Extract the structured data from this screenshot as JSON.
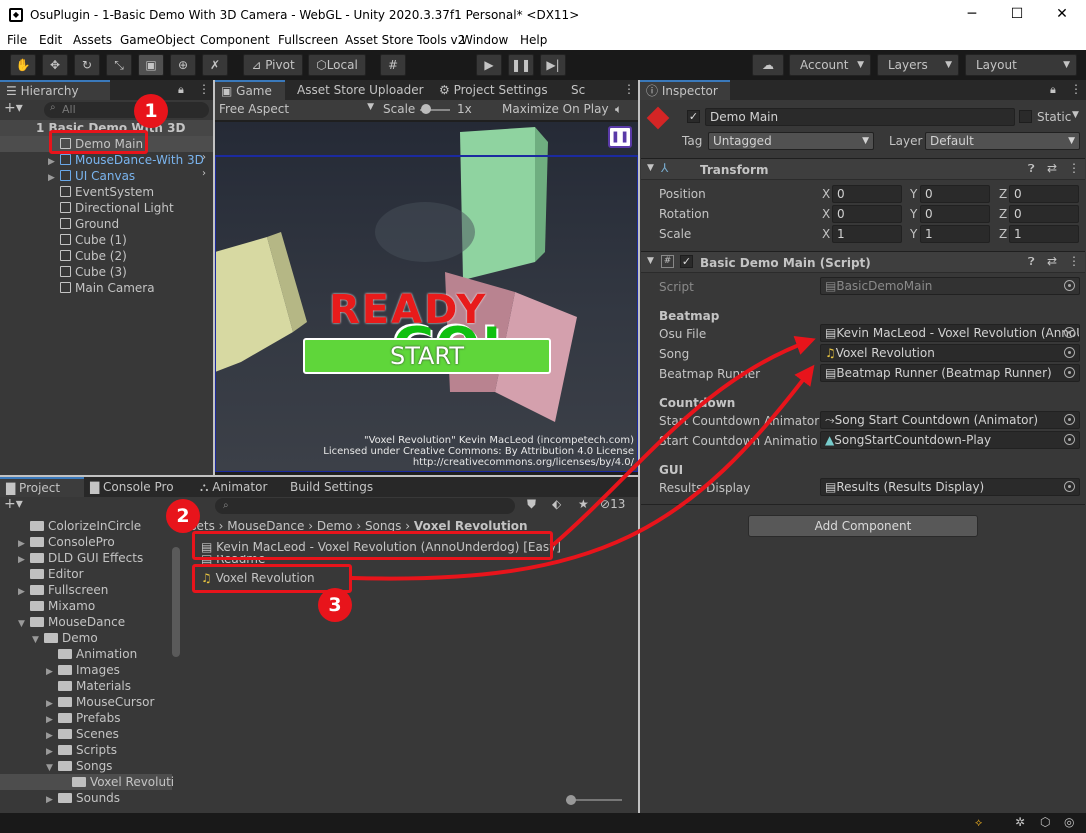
{
  "window": {
    "title": "OsuPlugin - 1-Basic Demo With 3D Camera - WebGL - Unity 2020.3.37f1 Personal* <DX11>"
  },
  "menu": [
    "File",
    "Edit",
    "Assets",
    "GameObject",
    "Component",
    "Fullscreen",
    "Asset Store Tools v2",
    "Window",
    "Help"
  ],
  "toolbar": {
    "pivot": "Pivot",
    "local": "Local",
    "account": "Account",
    "layers": "Layers",
    "layout": "Layout"
  },
  "hierarchy": {
    "tab": "Hierarchy",
    "search_placeholder": "All",
    "scene": "1 Basic Demo With 3D",
    "items": [
      "Demo Main",
      "MouseDance-With 3D",
      "UI Canvas",
      "EventSystem",
      "Directional Light",
      "Ground",
      "Cube (1)",
      "Cube (2)",
      "Cube (3)",
      "Main Camera"
    ]
  },
  "game": {
    "tabs": [
      "Game",
      "Asset Store Uploader",
      "Project Settings",
      "Sc"
    ],
    "aspect": "Free Aspect",
    "scale_label": "Scale",
    "scale_value": "1x",
    "maximize": "Maximize On Play",
    "ready": "READY",
    "go": "GO!",
    "start": "START",
    "credit_1": "\"Voxel Revolution\" Kevin MacLeod (incompetech.com)",
    "credit_2": "Licensed under Creative Commons: By Attribution 4.0 License",
    "credit_3": "http://creativecommons.org/licenses/by/4.0/"
  },
  "project": {
    "tabs": [
      "Project",
      "Console Pro",
      "Animator",
      "Build Settings"
    ],
    "hidden_count": "13",
    "tree": [
      {
        "label": "ColorizeInCircle",
        "indent": 1,
        "arrow": false
      },
      {
        "label": "ConsolePro",
        "indent": 1,
        "arrow": true
      },
      {
        "label": "DLD GUI Effects",
        "indent": 1,
        "arrow": true
      },
      {
        "label": "Editor",
        "indent": 1,
        "arrow": false
      },
      {
        "label": "Fullscreen",
        "indent": 1,
        "arrow": true
      },
      {
        "label": "Mixamo",
        "indent": 1,
        "arrow": false
      },
      {
        "label": "MouseDance",
        "indent": 1,
        "arrow": true,
        "open": true
      },
      {
        "label": "Demo",
        "indent": 2,
        "arrow": true,
        "open": true
      },
      {
        "label": "Animation",
        "indent": 3,
        "arrow": false
      },
      {
        "label": "Images",
        "indent": 3,
        "arrow": true
      },
      {
        "label": "Materials",
        "indent": 3,
        "arrow": false
      },
      {
        "label": "MouseCursor",
        "indent": 3,
        "arrow": true
      },
      {
        "label": "Prefabs",
        "indent": 3,
        "arrow": true
      },
      {
        "label": "Scenes",
        "indent": 3,
        "arrow": true
      },
      {
        "label": "Scripts",
        "indent": 3,
        "arrow": true
      },
      {
        "label": "Songs",
        "indent": 3,
        "arrow": true,
        "open": true
      },
      {
        "label": "Voxel Revoluti",
        "indent": 4,
        "arrow": false,
        "selected": true
      },
      {
        "label": "Sounds",
        "indent": 3,
        "arrow": true
      }
    ],
    "breadcrumb": [
      "ssets",
      "MouseDance",
      "Demo",
      "Songs",
      "Voxel Revolution"
    ],
    "files": [
      "Kevin MacLeod - Voxel Revolution (AnnoUnderdog) [Easy]",
      "Readme",
      "Voxel Revolution"
    ]
  },
  "inspector": {
    "tab": "Inspector",
    "object_name": "Demo Main",
    "static": "Static",
    "tag_label": "Tag",
    "tag_value": "Untagged",
    "layer_label": "Layer",
    "layer_value": "Default",
    "transform": {
      "title": "Transform",
      "rows": [
        {
          "label": "Position",
          "x": "0",
          "y": "0",
          "z": "0"
        },
        {
          "label": "Rotation",
          "x": "0",
          "y": "0",
          "z": "0"
        },
        {
          "label": "Scale",
          "x": "1",
          "y": "1",
          "z": "1"
        }
      ]
    },
    "script": {
      "title": "Basic Demo Main (Script)",
      "script_label": "Script",
      "script_value": "BasicDemoMain",
      "beatmap_header": "Beatmap",
      "osu_file_label": "Osu File",
      "osu_file_value": "Kevin MacLeod - Voxel Revolution (AnnoU",
      "song_label": "Song",
      "song_value": "Voxel Revolution",
      "runner_label": "Beatmap Runner",
      "runner_value": "Beatmap Runner (Beatmap Runner)",
      "countdown_header": "Countdown",
      "anim_label": "Start Countdown Animator",
      "anim_value": "Song Start Countdown (Animator)",
      "anim2_label": "Start Countdown Animation C",
      "anim2_value": "SongStartCountdown-Play",
      "gui_header": "GUI",
      "results_label": "Results Display",
      "results_value": "Results (Results Display)"
    },
    "add_component": "Add Component"
  },
  "callouts": [
    "1",
    "2",
    "3"
  ],
  "colors": {
    "accent": "#3a79bb",
    "highlight": "#e8141b",
    "selection": "#2c5d87"
  }
}
